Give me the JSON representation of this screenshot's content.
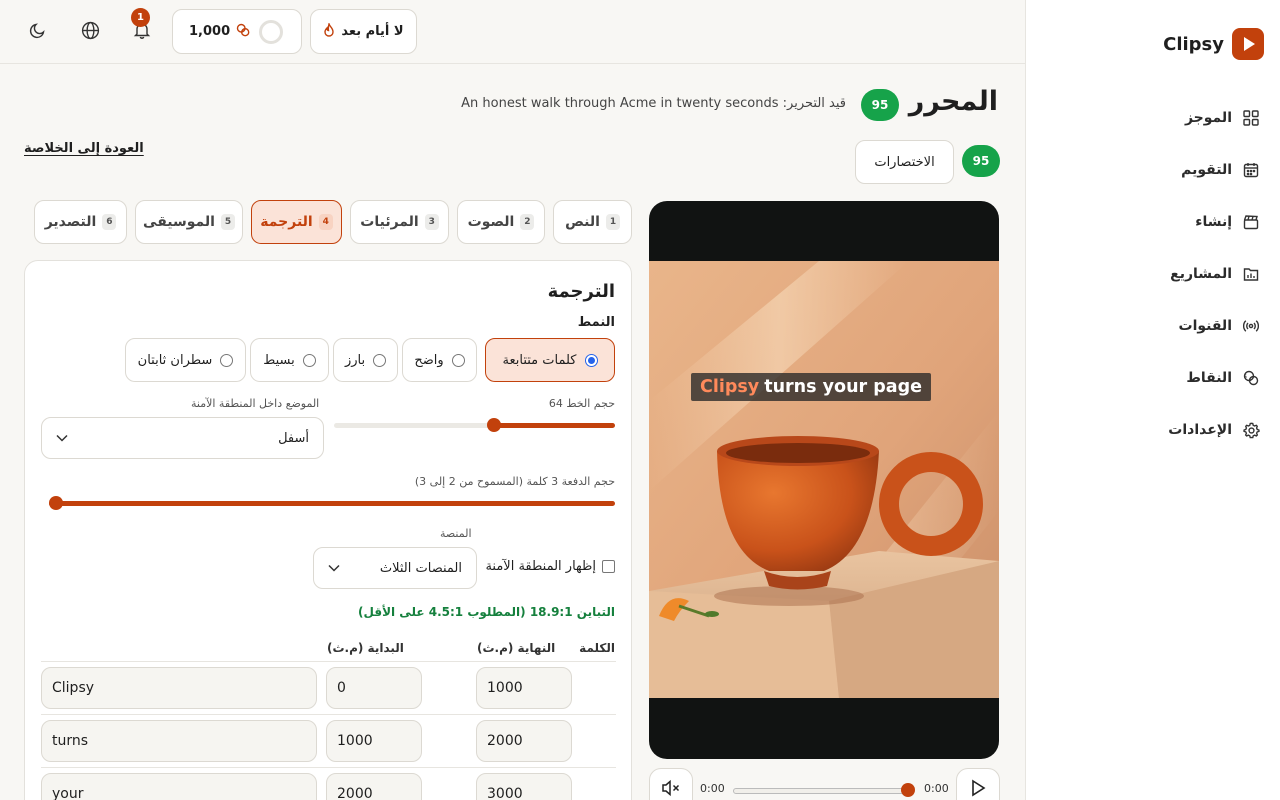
{
  "brand": {
    "name": "Clipsy"
  },
  "sidebar": {
    "items": [
      {
        "label": "الموجز",
        "icon": "grid-icon"
      },
      {
        "label": "التقويم",
        "icon": "calendar-icon"
      },
      {
        "label": "إنشاء",
        "icon": "clapperboard-icon"
      },
      {
        "label": "المشاريع",
        "icon": "folder-chart-icon"
      },
      {
        "label": "القنوات",
        "icon": "broadcast-icon"
      },
      {
        "label": "النقاط",
        "icon": "coins-icon"
      },
      {
        "label": "الإعدادات",
        "icon": "gear-icon"
      }
    ]
  },
  "topbar": {
    "streak_label": "لا أيام بعد",
    "points_value": "1,000",
    "notifications_count": "1"
  },
  "header": {
    "title": "المحرر",
    "score": "95",
    "draft_prefix": "قيد التحرير:",
    "draft_title": "An honest walk through Acme in twenty seconds",
    "back_link": "العودة إلى الخلاصة",
    "shortcuts_score": "95",
    "shortcuts_label": "الاختصارات"
  },
  "tabs": [
    {
      "num": "1",
      "label": "النص"
    },
    {
      "num": "2",
      "label": "الصوت"
    },
    {
      "num": "3",
      "label": "المرئيات"
    },
    {
      "num": "4",
      "label": "الترجمة",
      "active": true
    },
    {
      "num": "5",
      "label": "الموسيقى"
    },
    {
      "num": "6",
      "label": "التصدير"
    }
  ],
  "captions_panel": {
    "title": "الترجمة",
    "style_label": "النمط",
    "styles": [
      {
        "label": "كلمات متتابعة",
        "selected": true
      },
      {
        "label": "واضح"
      },
      {
        "label": "بارز"
      },
      {
        "label": "بسيط"
      },
      {
        "label": "سطران ثابتان"
      }
    ],
    "font_size_label": "حجم الخط 64",
    "font_size_value": 64,
    "font_size_fraction": 0.43,
    "position_label": "الموضع داخل المنطقة الآمنة",
    "position_value": "أسفل",
    "batch_label": "حجم الدفعة 3 كلمة (المسموح من 2 إلى 3)",
    "batch_value": 3,
    "batch_fraction": 1.0,
    "platform_label": "المنصة",
    "platform_value": "المنصات الثلاث",
    "safe_area_label": "إظهار المنطقة الآمنة",
    "contrast_text": "التباين 18.9:1 (المطلوب 4.5:1 على الأقل)",
    "table": {
      "headers": {
        "word": "الكلمة",
        "start": "البداية (م.ث)",
        "end": "النهاية (م.ث)"
      },
      "rows": [
        {
          "word": "Clipsy",
          "start": "0",
          "end": "1000"
        },
        {
          "word": "turns",
          "start": "1000",
          "end": "2000"
        },
        {
          "word": "your",
          "start": "2000",
          "end": "3000"
        }
      ]
    }
  },
  "preview": {
    "caption_highlight": "Clipsy",
    "caption_rest": "turns your page",
    "time_current": "0:00",
    "time_total": "0:00",
    "progress_fraction": 1.0
  },
  "colors": {
    "accent": "#c2410c",
    "accent_soft": "#fbe3d8",
    "success": "#16a34a"
  }
}
